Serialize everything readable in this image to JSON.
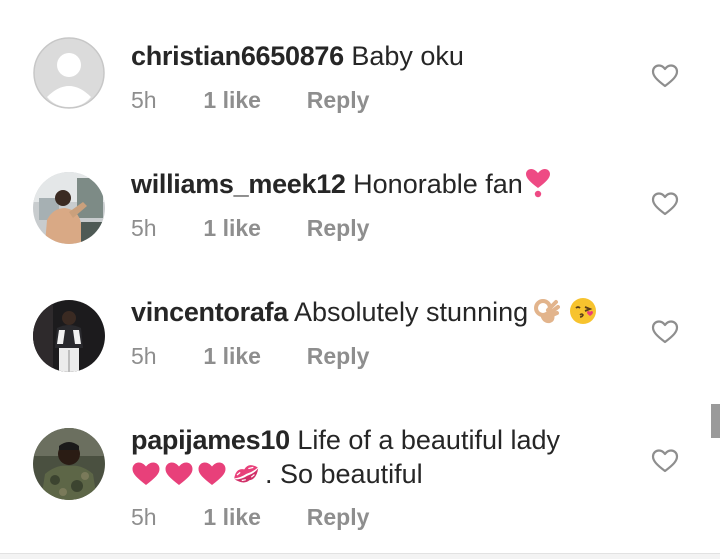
{
  "comments": [
    {
      "username": "christian6650876",
      "text": "Baby oku",
      "time": "5h",
      "likes": "1 like",
      "reply": "Reply",
      "avatar": "default-avatar"
    },
    {
      "username": "williams_meek12",
      "text": "Honorable fan",
      "emoji": "heart-exclamation-emoji",
      "time": "5h",
      "likes": "1 like",
      "reply": "Reply",
      "avatar": "user-photo"
    },
    {
      "username": "vincentorafa",
      "text": "Absolutely stunning",
      "emoji": [
        "ok-hand-emoji",
        "kissing-face-emoji"
      ],
      "time": "5h",
      "likes": "1 like",
      "reply": "Reply",
      "avatar": "user-photo"
    },
    {
      "username": "papijames10",
      "text": "Life of a beautiful lady",
      "second_line_text": ". So beautiful",
      "emoji": [
        "heart-emoji",
        "heart-emoji",
        "heart-emoji",
        "kiss-mark-emoji"
      ],
      "time": "5h",
      "likes": "1 like",
      "reply": "Reply",
      "avatar": "user-photo"
    }
  ],
  "colors": {
    "text": "#262626",
    "meta": "#8e8e8e",
    "heart_emoji": "#e8407a",
    "like_icon": "#8e8e8e"
  }
}
